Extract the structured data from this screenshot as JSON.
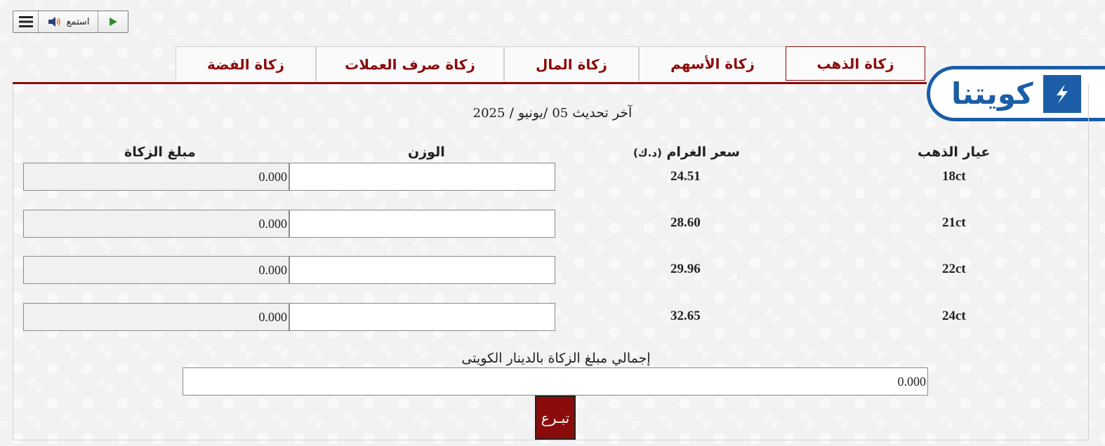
{
  "toolbar": {
    "menu_icon": "hamburger-icon",
    "listen_label": "استمع",
    "speaker_icon": "speaker-icon",
    "play_icon": "play-icon"
  },
  "logo": {
    "text": "كويتنا"
  },
  "tabs": [
    {
      "label": "زكاة الذهب",
      "active": true
    },
    {
      "label": "زكاة الأسهم",
      "active": false
    },
    {
      "label": "زكاة المال",
      "active": false
    },
    {
      "label": "زكاة صرف العملات",
      "active": false
    },
    {
      "label": "زكاة الفضة",
      "active": false
    }
  ],
  "updated": {
    "prefix": "آخر تحديث",
    "day": "05",
    "month": "/يونيو /",
    "year": "2025"
  },
  "headers": {
    "karat": "عيار الذهب",
    "price": "سعر الغرام",
    "price_unit": "(د.ك)",
    "weight": "الوزن",
    "zakat": "مبلغ الزكاة"
  },
  "rows": [
    {
      "karat": "18ct",
      "price": "24.51",
      "weight": "",
      "zakat": "0.000"
    },
    {
      "karat": "21ct",
      "price": "28.60",
      "weight": "",
      "zakat": "0.000"
    },
    {
      "karat": "22ct",
      "price": "29.96",
      "weight": "",
      "zakat": "0.000"
    },
    {
      "karat": "24ct",
      "price": "32.65",
      "weight": "",
      "zakat": "0.000"
    }
  ],
  "total": {
    "label": "إجمالي مبلغ الزكاة بالدينار الكويتى",
    "value": "0.000"
  },
  "donate_label": "تبـرع",
  "colors": {
    "accent": "#8b0b0b",
    "brand": "#1b5da6"
  }
}
